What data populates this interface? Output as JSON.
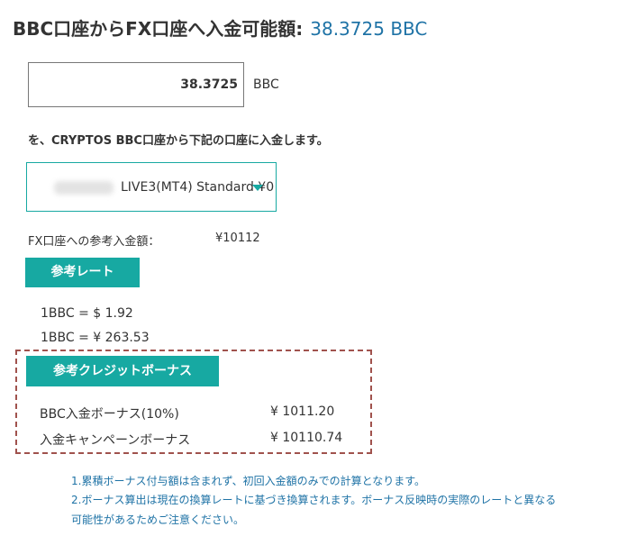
{
  "header": {
    "title": "BBC口座からFX口座へ入金可能額:",
    "amount": "38.3725 BBC"
  },
  "deposit": {
    "input_value": "38.3725",
    "unit": "BBC",
    "instruction": "を、CRYPTOS BBC口座から下記の口座に入金します。"
  },
  "account_select": {
    "selected": "LIVE3(MT4) Standard ¥0"
  },
  "reference_amount": {
    "label": "FX口座への参考入金額：",
    "value": "¥10112"
  },
  "reference_rate": {
    "button": "参考レート",
    "usd": "1BBC = $ 1.92",
    "jpy": "1BBC = ¥ 263.53"
  },
  "credit_bonus": {
    "button": "参考クレジットボーナス",
    "rows": [
      {
        "label": "BBC入金ボーナス(10%)",
        "value": "¥ 1011.20"
      },
      {
        "label": "入金キャンペーンボーナス",
        "value": "¥ 10110.74"
      }
    ]
  },
  "notes": [
    "1.累積ボーナス付与額は含まれず、初回入金額のみでの計算となります。",
    "2.ボーナス算出は現在の換算レートに基づき換算されます。ボーナス反映時の実際のレートと異なる",
    "可能性があるためご注意ください。"
  ],
  "colors": {
    "accent_teal": "#17a9a2",
    "link_blue": "#1f73a6",
    "dashed_border": "#a0524d"
  },
  "icons": {
    "dropdown": "chevron-down-icon"
  }
}
